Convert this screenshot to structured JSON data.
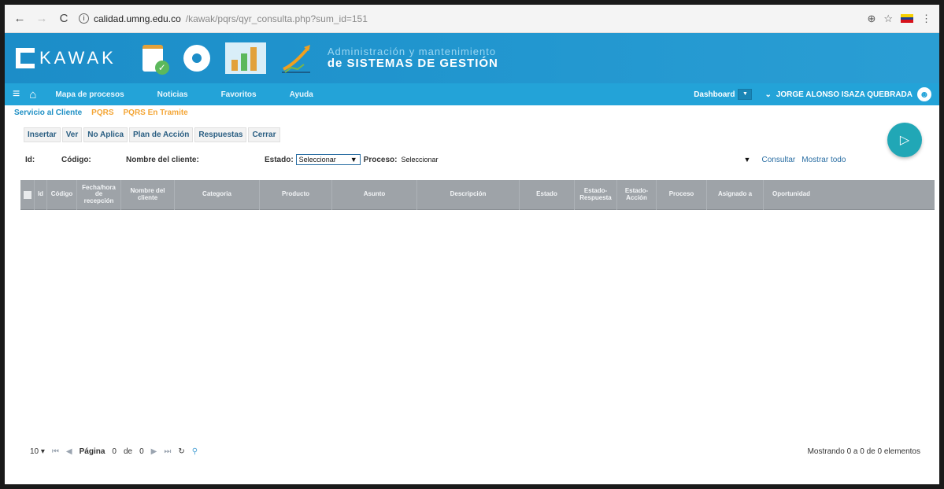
{
  "browser": {
    "back": "←",
    "forward": "→",
    "reload": "C",
    "info": "i",
    "url_host": "calidad.umng.edu.co",
    "url_path": "/kawak/pqrs/qyr_consulta.php?sum_id=151",
    "zoom_icon": "⊕",
    "star_icon": "☆",
    "menu_icon": "⋮"
  },
  "header": {
    "logo": "KAWAK",
    "subtitle": "Administración y mantenimiento",
    "title_prefix": "de ",
    "title": "SISTEMAS DE GESTIÓN"
  },
  "nav": {
    "hamburger": "≡",
    "home": "⌂",
    "links": [
      "Mapa de procesos",
      "Noticias",
      "Favoritos",
      "Ayuda"
    ],
    "dashboard": "Dashboard",
    "dashboard_select": "▼",
    "user_caret": "⌄",
    "user": "JORGE ALONSO ISAZA QUEBRADA",
    "avatar": "☻"
  },
  "breadcrumb": [
    "Servicio al Cliente",
    "PQRS",
    "PQRS En Tramite"
  ],
  "toolbar": [
    "Insertar",
    "Ver",
    "No Aplica",
    "Plan de Acción",
    "Respuestas",
    "Cerrar"
  ],
  "fab_icon": "▷",
  "filters": {
    "id": "Id:",
    "codigo": "Código:",
    "nombre": "Nombre del cliente:",
    "estado": "Estado:",
    "estado_value": "Seleccionar",
    "caret": "▼",
    "proceso": "Proceso:",
    "proceso_value": "Seleccionar",
    "consultar": "Consultar",
    "mostrar_todo": "Mostrar todo"
  },
  "table": {
    "columns": [
      "Id",
      "Código",
      "Fecha/hora de recepción",
      "Nombre del cliente",
      "Categoria",
      "Producto",
      "Asunto",
      "Descripción",
      "Estado",
      "Estado-Respuesta",
      "Estado-Acción",
      "Proceso",
      "Asignado a",
      "Oportunidad"
    ]
  },
  "pager": {
    "per_page": "10 ▾",
    "first": "⏮",
    "prev": "◀",
    "page_label": "Página",
    "page": "0",
    "of": "de",
    "total_pages": "0",
    "next": "▶",
    "last": "⏭",
    "refresh": "↻",
    "search": "⚲"
  },
  "count_text": "Mostrando 0 a 0 de 0 elementos",
  "colors": {
    "header_blue": "#1c8dc8",
    "nav_blue": "#23a3d8",
    "grid_gray": "#9ea3a8",
    "accent_orange": "#f4a637",
    "fab_teal": "#21a7b6"
  }
}
